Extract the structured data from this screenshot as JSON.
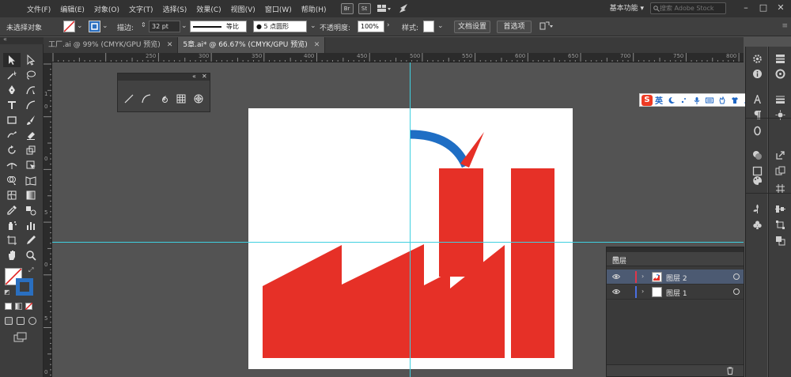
{
  "menubar": {
    "items": [
      "文件(F)",
      "编辑(E)",
      "对象(O)",
      "文字(T)",
      "选择(S)",
      "效果(C)",
      "视图(V)",
      "窗口(W)",
      "帮助(H)"
    ],
    "bridge_label": "Br",
    "stock_label": "St",
    "workspace": "基本功能",
    "search_placeholder": "搜索 Adobe Stock"
  },
  "controlbar": {
    "selection_status": "未选择对象",
    "stroke_label": "描边:",
    "stroke_value": "32 pt",
    "stroke_profile": "等比",
    "brush": "5 点圆形",
    "opacity_label": "不透明度:",
    "opacity_value": "100%",
    "style_label": "样式:",
    "doc_setup": "文档设置",
    "preferences": "首选项"
  },
  "tabs": [
    {
      "label": "工厂.ai @ 99% (CMYK/GPU 预览)",
      "active": false
    },
    {
      "label": "5章.ai* @ 66.67% (CMYK/GPU 预览)",
      "active": true
    }
  ],
  "ruler": {
    "h_labels": [
      "250",
      "300",
      "350",
      "400",
      "450",
      "500",
      "550",
      "600",
      "650",
      "700",
      "750",
      "800",
      "850"
    ],
    "v_labels": [
      "1",
      "0",
      "0",
      "5",
      "0",
      "5",
      "0"
    ]
  },
  "ime": {
    "lang": "英"
  },
  "layers_panel": {
    "title": "图层",
    "layers": [
      {
        "name": "图层 2",
        "color": "#e0364a",
        "selected": true
      },
      {
        "name": "图层 1",
        "color": "#4a6fe0",
        "selected": false
      }
    ]
  },
  "colors": {
    "factory_red": "#e63027",
    "arrow_blue": "#1f6ec4",
    "guide_cyan": "#3fd0e0",
    "ui_dark": "#323232",
    "canvas_bg": "#535353"
  }
}
